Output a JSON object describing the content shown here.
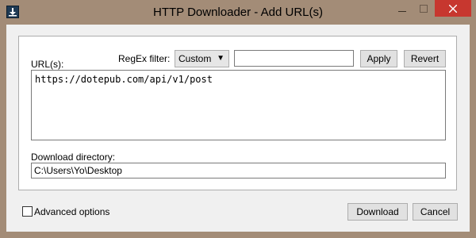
{
  "window": {
    "title": "HTTP Downloader - Add URL(s)",
    "close_color": "#c7372f",
    "frame_color": "#a38c77"
  },
  "icons": {
    "app": "download-icon",
    "minimize": "minimize-icon",
    "maximize": "maximize-icon",
    "close": "close-icon"
  },
  "regex": {
    "label": "RegEx filter:",
    "selected": "Custom",
    "input_value": "",
    "apply_label": "Apply",
    "revert_label": "Revert"
  },
  "urls": {
    "label": "URL(s):",
    "value": "https://dotepub.com/api/v1/post"
  },
  "directory": {
    "label": "Download directory:",
    "value": "C:\\Users\\Yo\\Desktop"
  },
  "advanced": {
    "label": "Advanced options",
    "checked": false
  },
  "actions": {
    "download_label": "Download",
    "cancel_label": "Cancel"
  }
}
